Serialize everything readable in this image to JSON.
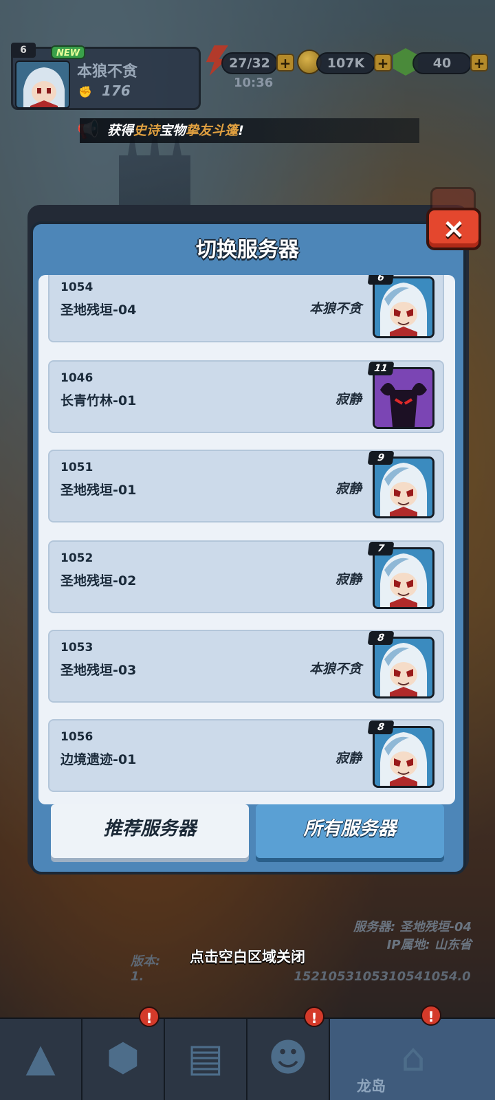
{
  "hud": {
    "player_level": "6",
    "new_badge": "NEW",
    "player_name": "本狼不贪",
    "power": "176",
    "energy": "27/32",
    "coins": "107K",
    "gems": "40",
    "timer": "10:36",
    "plus": "+"
  },
  "announcement": {
    "prefix": "获得",
    "rarity": "史诗",
    "middle": "宝物",
    "item": "挚友斗篷",
    "suffix": "!"
  },
  "modal": {
    "title": "切换服务器",
    "close_label": "×"
  },
  "servers": [
    {
      "id": "1054",
      "name": "圣地残垣-04",
      "player": "本狼不贪",
      "level": "6",
      "avatar": "white-hair"
    },
    {
      "id": "1046",
      "name": "长青竹林-01",
      "player": "寂静",
      "level": "11",
      "avatar": "purple-demon"
    },
    {
      "id": "1051",
      "name": "圣地残垣-01",
      "player": "寂静",
      "level": "9",
      "avatar": "white-hair"
    },
    {
      "id": "1052",
      "name": "圣地残垣-02",
      "player": "寂静",
      "level": "7",
      "avatar": "white-hair"
    },
    {
      "id": "1053",
      "name": "圣地残垣-03",
      "player": "本狼不贪",
      "level": "8",
      "avatar": "white-hair"
    },
    {
      "id": "1056",
      "name": "边境遗迹-01",
      "player": "寂静",
      "level": "8",
      "avatar": "white-hair"
    }
  ],
  "tabs": {
    "recommended": "推荐服务器",
    "all": "所有服务器"
  },
  "footer_info": {
    "server_line": "服务器: 圣地残垣-04",
    "ip_line": "IP属地: 山东省",
    "version_prefix": "版本: 1.",
    "version_tail": "1521053105310541054.0",
    "close_hint": "点击空白区域关闭"
  },
  "bottom_nav": [
    {
      "icon": "crystal-icon",
      "label": "",
      "badge": ""
    },
    {
      "icon": "rune-shield-icon",
      "label": "",
      "badge": "!"
    },
    {
      "icon": "map-icon",
      "label": "",
      "badge": ""
    },
    {
      "icon": "hero-icon",
      "label": "",
      "badge": "!"
    },
    {
      "icon": "dragon-island-icon",
      "label": "龙岛",
      "badge": "!"
    }
  ],
  "colors": {
    "modal_blue": "#4d86b8",
    "close_red": "#e4472e",
    "highlight_orange": "#e0a040"
  }
}
